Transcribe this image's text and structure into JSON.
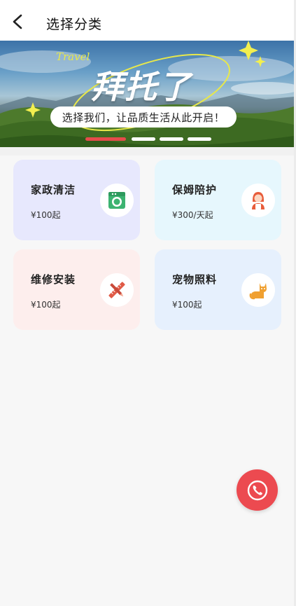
{
  "header": {
    "title": "选择分类",
    "back_icon": "chevron-left-icon"
  },
  "banner": {
    "script_word": "Travel",
    "headline": "拜托了",
    "tagline": "选择我们，让品质生活从此开启！",
    "active_slide": 1,
    "slide_count": 4,
    "accent": "#e54b4b"
  },
  "services": [
    {
      "name": "家政清洁",
      "price": "¥100起",
      "icon": "washing-machine-icon",
      "bg": "#e7e8fd"
    },
    {
      "name": "保姆陪护",
      "price": "¥300/天起",
      "icon": "nanny-icon",
      "bg": "#e6f7fd"
    },
    {
      "name": "维修安装",
      "price": "¥100起",
      "icon": "tools-icon",
      "bg": "#fdeeed"
    },
    {
      "name": "宠物照料",
      "price": "¥100起",
      "icon": "cat-icon",
      "bg": "#e6f0fd"
    }
  ],
  "fab": {
    "icon": "phone-icon",
    "color": "#ec4a50"
  }
}
